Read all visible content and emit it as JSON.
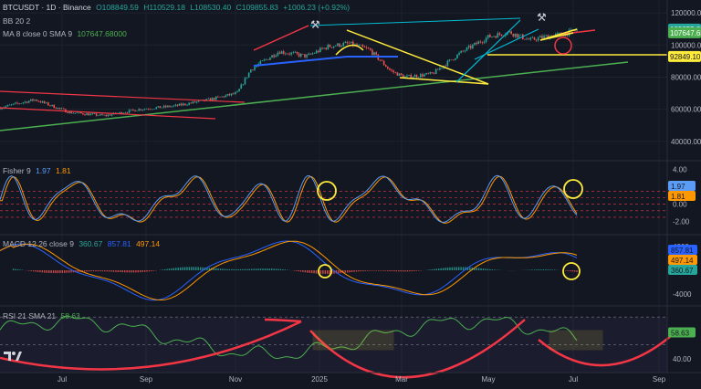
{
  "header": {
    "symbol": "BTCUSDT · 1D · Binance",
    "open": "O108849.59",
    "high": "H110529.18",
    "low": "L108530.40",
    "close": "C109855.83",
    "change": "+1006.23 (+0.92%)",
    "bb_label": "BB 20 2",
    "ma_label": "MA 8 close 0 SMA 9",
    "ma_value": "107647.68000"
  },
  "fisher": {
    "label": "Fisher 9",
    "v1": "1.97",
    "v2": "1.81"
  },
  "macd": {
    "label": "MACD 12 26 close 9",
    "v1": "360.67",
    "v2": "857.81",
    "v3": "497.14"
  },
  "rsi": {
    "label": "RSI 21 SMA 21",
    "value": "58.63"
  },
  "colors": {
    "bg": "#131722",
    "up": "#26a69a",
    "down": "#ef5350",
    "yellow": "#ffeb3b",
    "green_line": "#4caf50",
    "red_line": "#f23645",
    "blue_line": "#2962ff",
    "cyan_line": "#22ab94",
    "orange": "#ff9800",
    "fisher_blue": "#5b9cf6",
    "macd_blue": "#2962ff",
    "signal_orange": "#ff9800",
    "rsi_green": "#4caf50"
  },
  "chart_data": [
    {
      "type": "line",
      "title": "BTCUSDT 1D Binance — price",
      "x_ticks": [
        "Jul",
        "Sep",
        "Nov",
        "2025",
        "Mar",
        "May",
        "Jul",
        "Sep"
      ],
      "y_ticks": [
        40000,
        60000,
        80000,
        100000,
        120000
      ],
      "ylim": [
        28000,
        128000
      ],
      "price_labels": [
        {
          "text": "109855.83",
          "value": 109855.83,
          "color": "#26a69a"
        },
        {
          "text": "107647.68",
          "value": 107647.68,
          "color": "#4caf50"
        },
        {
          "text": "92849.10",
          "value": 92849.1,
          "color": "#ffeb3b"
        }
      ],
      "series": [
        {
          "name": "close",
          "x": [
            0,
            0.05,
            0.1,
            0.15,
            0.2,
            0.25,
            0.3,
            0.34,
            0.36,
            0.4,
            0.44,
            0.47,
            0.5,
            0.53,
            0.56,
            0.58,
            0.62,
            0.66,
            0.7,
            0.73,
            0.76,
            0.78,
            0.81,
            0.83
          ],
          "values": [
            61000,
            66000,
            58000,
            56000,
            60000,
            62000,
            66000,
            70000,
            85000,
            96000,
            93000,
            99000,
            101000,
            97000,
            84000,
            80000,
            82000,
            95000,
            105000,
            108000,
            103000,
            105000,
            107000,
            109855
          ]
        }
      ],
      "annotations": [
        "ascending support trendline",
        "descending wedge",
        "triangle",
        "horizontal support 92849.10"
      ]
    },
    {
      "type": "line",
      "title": "Fisher 9",
      "ylim": [
        -3.5,
        5
      ],
      "y_ticks": [
        4.0,
        2.0,
        0.0,
        -2.0
      ],
      "last_values": [
        1.97,
        1.81
      ]
    },
    {
      "type": "bar",
      "title": "MACD 12 26 close 9",
      "ylim": [
        -6000,
        6000
      ],
      "y_ticks": [
        4000,
        0,
        -4000
      ],
      "last_values": {
        "histogram": 360.67,
        "macd": 857.81,
        "signal": 497.14
      }
    },
    {
      "type": "line",
      "title": "RSI 21 SMA 21",
      "ylim": [
        30,
        78
      ],
      "y_ticks": [
        60.0,
        40.0
      ],
      "last_value": 58.63
    }
  ]
}
